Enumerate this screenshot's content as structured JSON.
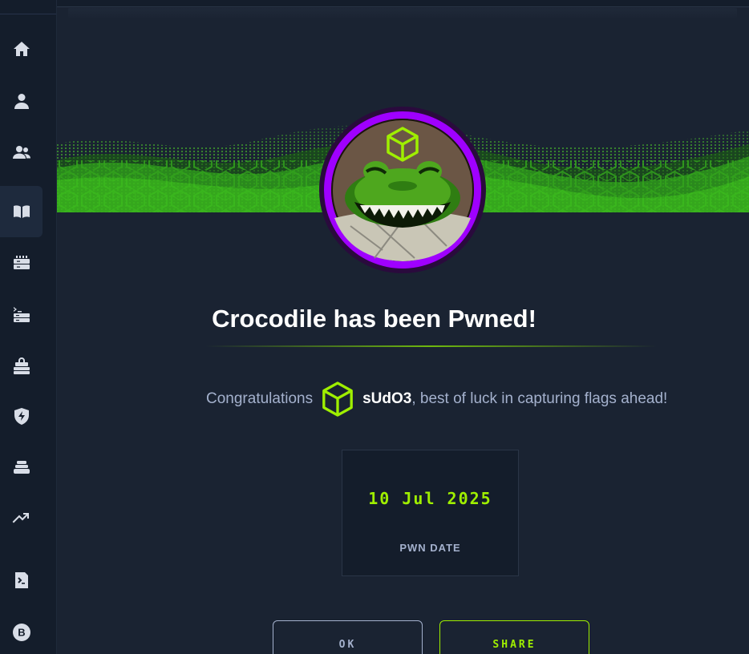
{
  "sidebar": {
    "items": [
      {
        "icon": "home-icon"
      },
      {
        "icon": "user-icon"
      },
      {
        "icon": "users-icon"
      },
      {
        "icon": "book-icon",
        "active": true
      },
      {
        "icon": "server-icon"
      },
      {
        "icon": "terminal-server-icon"
      },
      {
        "icon": "lock-server-icon"
      },
      {
        "icon": "shield-bolt-icon"
      },
      {
        "icon": "layers-icon"
      },
      {
        "icon": "trending-up-icon"
      },
      {
        "icon": "terminal-file-icon"
      },
      {
        "icon": "bitcoin-badge-icon",
        "label": "B"
      }
    ]
  },
  "modal": {
    "title": "Crocodile has been Pwned!",
    "congrats_prefix": "Congratulations",
    "username": "sUdO3",
    "congrats_suffix": ", best of luck in capturing flags ahead!",
    "pwn_date": "10 Jul 2025",
    "pwn_date_label": "PWN DATE",
    "ok_label": "OK",
    "share_label": "SHARE"
  },
  "colors": {
    "accent": "#9fef00",
    "avatar_ring": "#9f00ff",
    "background": "#1a2332",
    "sidebar": "#141d2b"
  }
}
